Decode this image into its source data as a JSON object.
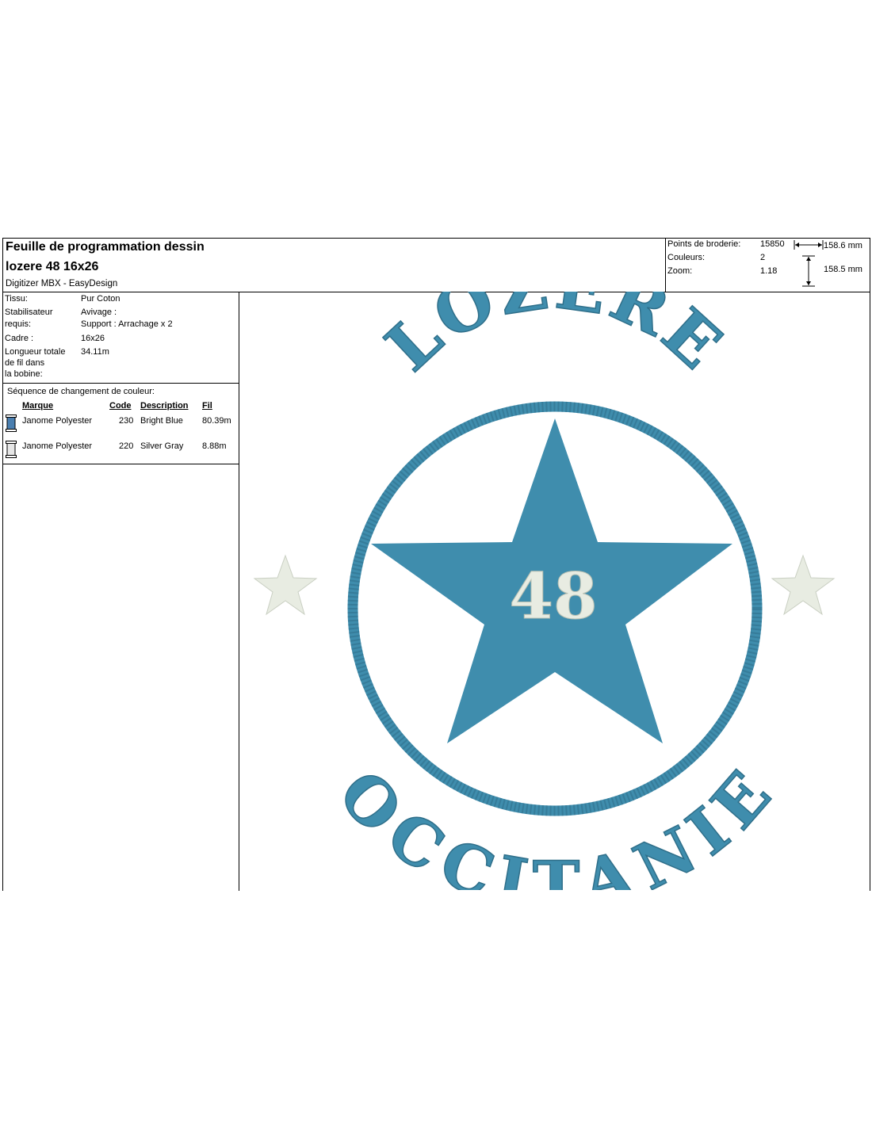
{
  "header": {
    "title": "Feuille de programmation dessin",
    "design_name": "lozere 48 16x26",
    "software": "Digitizer MBX - EasyDesign"
  },
  "stats": {
    "stitches_label": "Points de broderie:",
    "stitches_value": "15850",
    "colors_label": "Couleurs:",
    "colors_value": "2",
    "zoom_label": "Zoom:",
    "zoom_value": "1.18",
    "width": "158.6 mm",
    "height": "158.5 mm"
  },
  "info": {
    "fabric_label": "Tissu:",
    "fabric_value": "Pur Coton",
    "stabilizer_label_1": "Stabilisateur",
    "stabilizer_label_2": "requis:",
    "stabilizer_value_1": "Avivage :",
    "stabilizer_value_2": "Support : Arrachage x 2",
    "frame_label": "Cadre :",
    "frame_value": "16x26",
    "thread_label_1": "Longueur totale",
    "thread_label_2": "de fil dans",
    "thread_label_3": "la bobine:",
    "thread_value": "34.11m"
  },
  "sequence": {
    "title": "Séquence de changement de couleur:",
    "headers": {
      "brand": "Marque",
      "code": "Code",
      "description": "Description",
      "thread": "Fil"
    },
    "rows": [
      {
        "brand": "Janome Polyester",
        "code": "230",
        "description": "Bright Blue",
        "thread": "80.39m",
        "color": "#4a7fb0"
      },
      {
        "brand": "Janome Polyester",
        "code": "220",
        "description": "Silver Gray",
        "thread": "8.88m",
        "color": "#e6e6e6"
      }
    ]
  },
  "design": {
    "top_text": "LOZERE",
    "bottom_text": "OCCITANIE",
    "center_number": "48",
    "blue": "#3f8dad",
    "silver": "#e8ece2"
  }
}
